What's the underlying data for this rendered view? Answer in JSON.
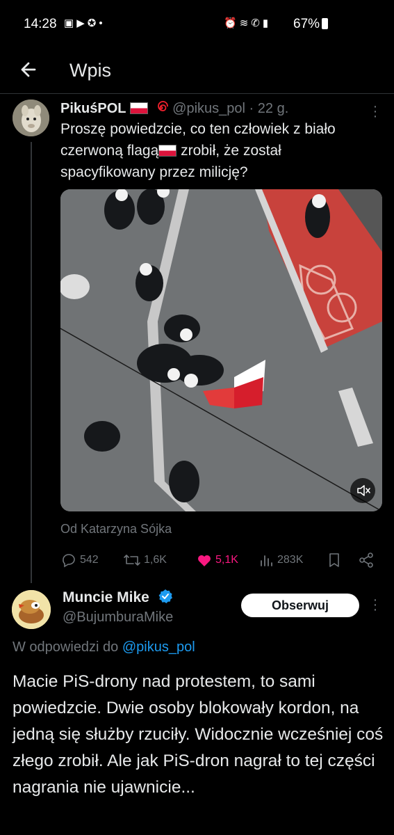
{
  "status_bar": {
    "time": "14:28",
    "left_icons": [
      "image-icon",
      "youtube-icon",
      "messenger-icon",
      "dot-icon"
    ],
    "right_icons": [
      "alarm-icon",
      "wifi-icon",
      "wifi-call-icon",
      "signal-icon"
    ],
    "battery": "67%"
  },
  "header": {
    "title": "Wpis",
    "back_icon": "arrow-left-icon"
  },
  "tweet": {
    "author_name": "PikuśPOL",
    "author_handle": "@pikus_pol",
    "time": "· 22 g.",
    "text_part1": "Proszę powiedzcie, co ten człowiek z biało czerwoną flagą",
    "text_part2": " zrobił, że został spacyfikowany przez milicję?",
    "attribution": "Od Katarzyna Sójka",
    "stats": {
      "replies": "542",
      "reposts": "1,6K",
      "likes": "5,1K",
      "views": "283K"
    },
    "like_color": "#f91880"
  },
  "reply": {
    "author_name": "Muncie Mike",
    "author_handle": "@BujumburaMike",
    "follow_label": "Obserwuj",
    "reply_prefix": "W odpowiedzi do",
    "reply_to_handle": "@pikus_pol",
    "text": "Macie PiS-drony nad protestem, to sami powiedzcie. Dwie osoby blokowały kordon, na jedną się służby rzuciły. Widocznie wcześniej coś złego zrobił. Ale jak PiS-dron nagrał to tej części nagrania nie ujawnicie..."
  },
  "colors": {
    "accent": "#1d9bf0",
    "muted": "#71767b",
    "text": "#e7e9ea",
    "background": "#000000"
  }
}
